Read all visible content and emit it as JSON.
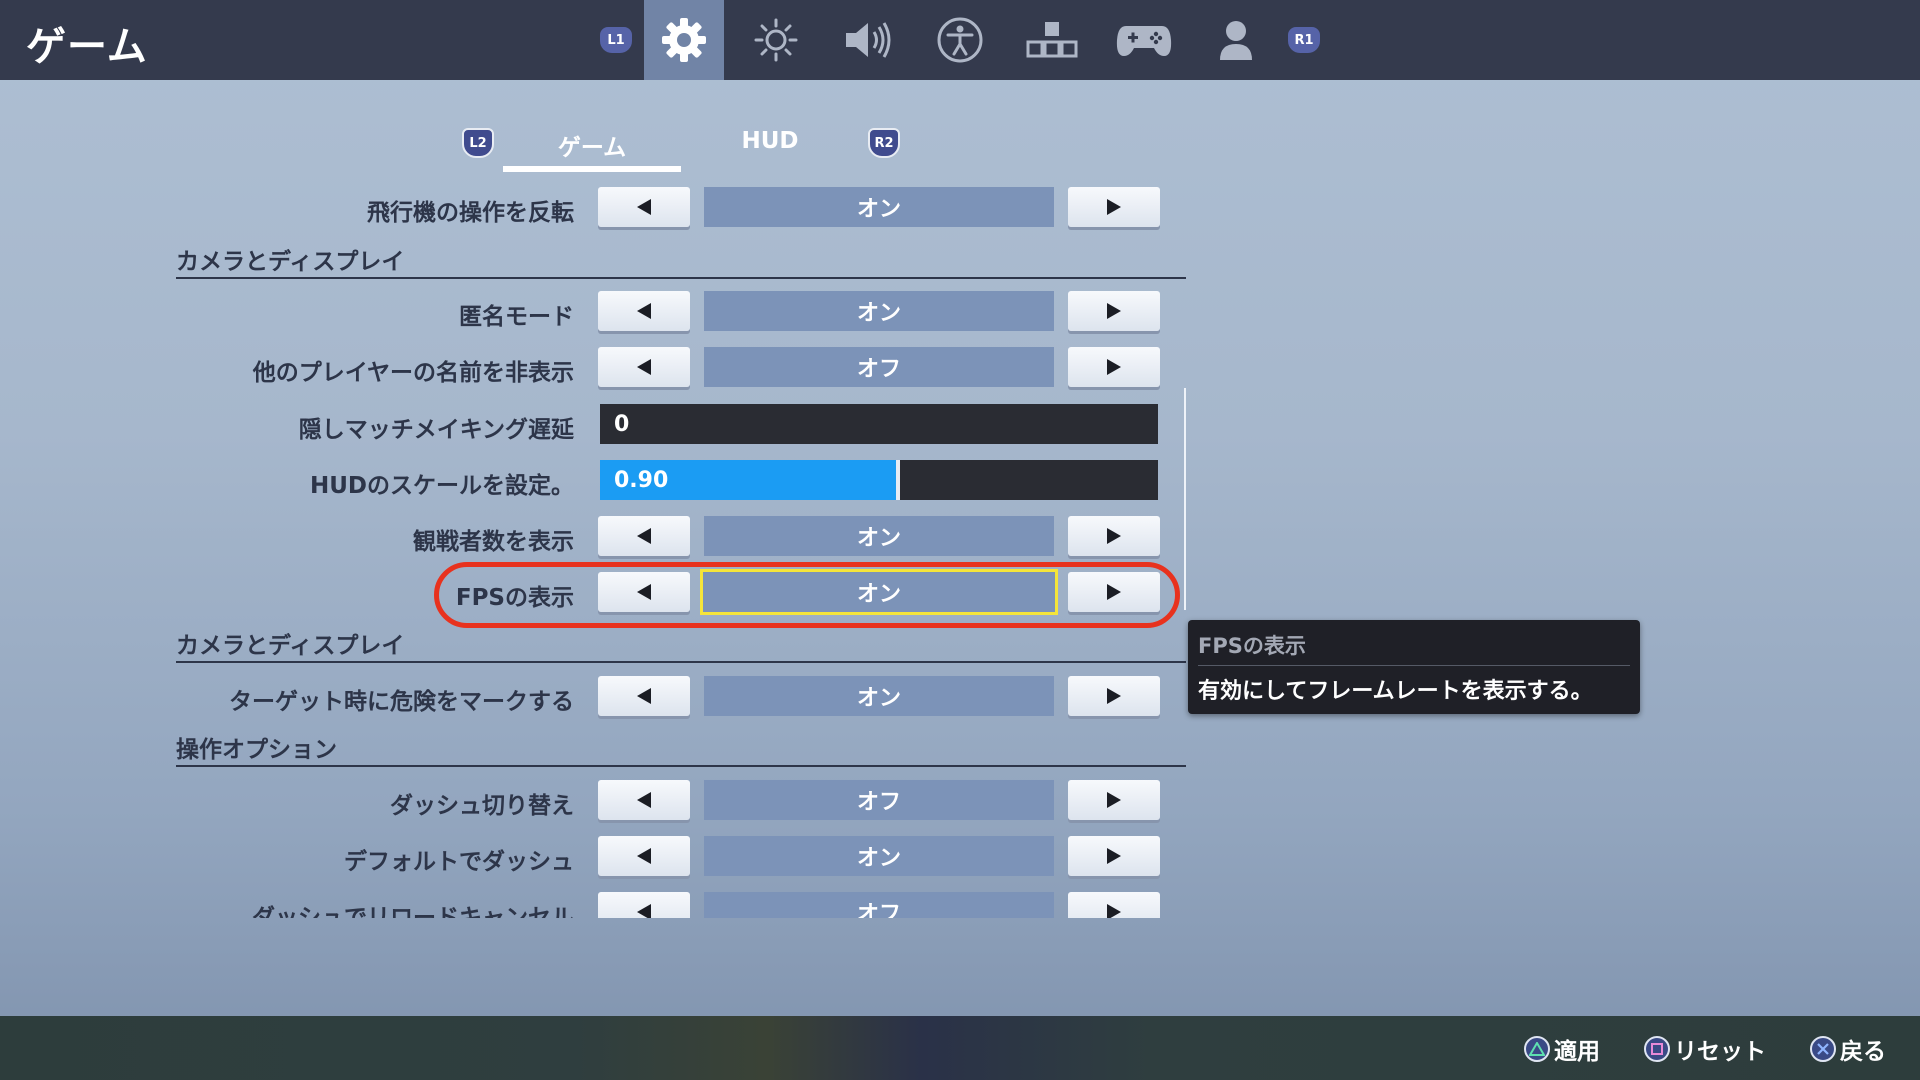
{
  "header": {
    "title": "ゲーム",
    "left_shoulder": "L1",
    "right_shoulder": "R1",
    "icons": [
      "gear-icon",
      "brightness-icon",
      "volume-icon",
      "accessibility-icon",
      "input-icon",
      "controller-icon",
      "account-icon"
    ],
    "active_icon": "gear-icon"
  },
  "tabs": {
    "left_trigger": "L2",
    "right_trigger": "R2",
    "items": [
      {
        "label": "ゲーム",
        "active": true
      },
      {
        "label": "HUD",
        "active": false
      }
    ]
  },
  "settings": {
    "row0": {
      "label": "飛行機の操作を反転",
      "value": "オン"
    },
    "section1": "カメラとディスプレイ",
    "row1": {
      "label": "匿名モード",
      "value": "オン"
    },
    "row2": {
      "label": "他のプレイヤーの名前を非表示",
      "value": "オフ"
    },
    "row3": {
      "label": "隠しマッチメイキング遅延",
      "value": "0"
    },
    "row4": {
      "label": "HUDのスケールを設定。",
      "value": "0.90",
      "slider_fraction": 0.53
    },
    "row5": {
      "label": "観戦者数を表示",
      "value": "オン"
    },
    "row6": {
      "label": "FPSの表示",
      "value": "オン"
    },
    "section2": "カメラとディスプレイ",
    "row7": {
      "label": "ターゲット時に危険をマークする",
      "value": "オン"
    },
    "section3": "操作オプション",
    "row8": {
      "label": "ダッシュ切り替え",
      "value": "オフ"
    },
    "row9": {
      "label": "デフォルトでダッシュ",
      "value": "オン"
    },
    "row10": {
      "label": "ダッシュでリロードキャンセル",
      "value": "オフ"
    }
  },
  "tooltip": {
    "title": "FPSの表示",
    "body": "有効にしてフレームレートを表示する。"
  },
  "footer": {
    "apply": "適用",
    "reset": "リセット",
    "back": "戻る"
  },
  "colors": {
    "topbar": "#343a4d",
    "active_icon_bg": "#7184a6",
    "value_box": "#7c93b8",
    "slider_fill": "#1b9cf3",
    "focus_border": "#f5e53a",
    "highlight_ring": "#e8321e"
  }
}
